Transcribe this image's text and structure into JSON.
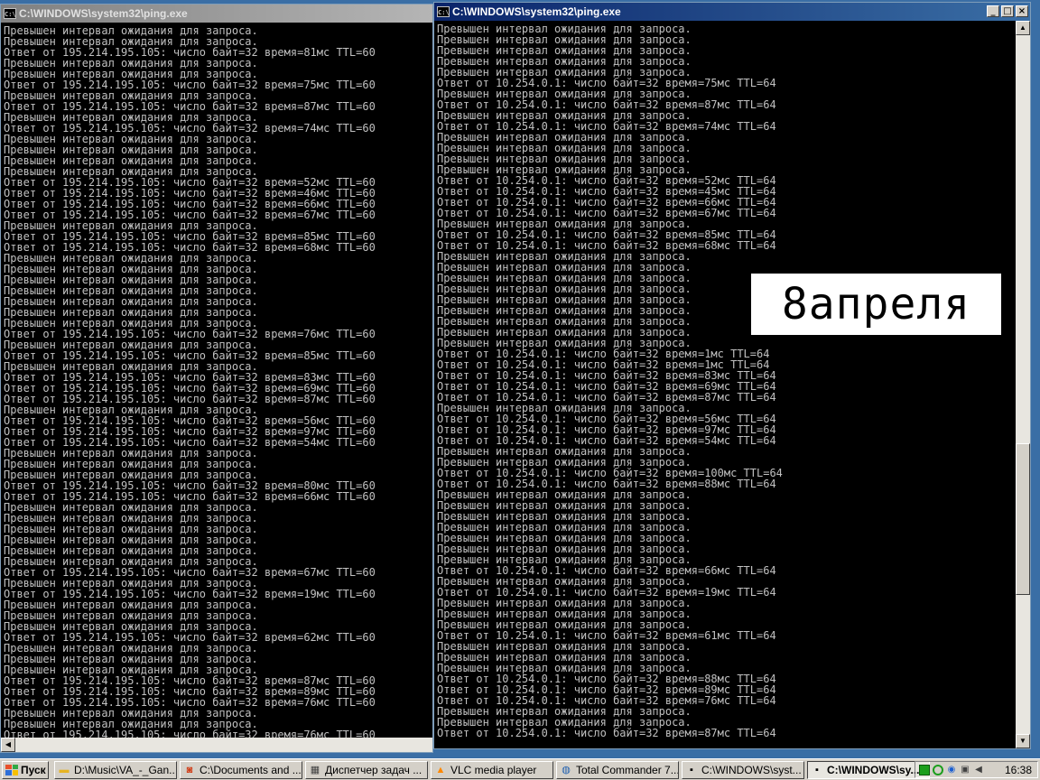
{
  "left_window": {
    "title": "C:\\WINDOWS\\system32\\ping.exe",
    "lines": [
      "Превышен интервал ожидания для запроса.",
      "Превышен интервал ожидания для запроса.",
      "Ответ от 195.214.195.105: число байт=32 время=81мс TTL=60",
      "Превышен интервал ожидания для запроса.",
      "Превышен интервал ожидания для запроса.",
      "Ответ от 195.214.195.105: число байт=32 время=75мс TTL=60",
      "Превышен интервал ожидания для запроса.",
      "Ответ от 195.214.195.105: число байт=32 время=87мс TTL=60",
      "Превышен интервал ожидания для запроса.",
      "Ответ от 195.214.195.105: число байт=32 время=74мс TTL=60",
      "Превышен интервал ожидания для запроса.",
      "Превышен интервал ожидания для запроса.",
      "Превышен интервал ожидания для запроса.",
      "Превышен интервал ожидания для запроса.",
      "Ответ от 195.214.195.105: число байт=32 время=52мс TTL=60",
      "Ответ от 195.214.195.105: число байт=32 время=46мс TTL=60",
      "Ответ от 195.214.195.105: число байт=32 время=66мс TTL=60",
      "Ответ от 195.214.195.105: число байт=32 время=67мс TTL=60",
      "Превышен интервал ожидания для запроса.",
      "Ответ от 195.214.195.105: число байт=32 время=85мс TTL=60",
      "Ответ от 195.214.195.105: число байт=32 время=68мс TTL=60",
      "Превышен интервал ожидания для запроса.",
      "Превышен интервал ожидания для запроса.",
      "Превышен интервал ожидания для запроса.",
      "Превышен интервал ожидания для запроса.",
      "Превышен интервал ожидания для запроса.",
      "Превышен интервал ожидания для запроса.",
      "Превышен интервал ожидания для запроса.",
      "Ответ от 195.214.195.105: число байт=32 время=76мс TTL=60",
      "Превышен интервал ожидания для запроса.",
      "Ответ от 195.214.195.105: число байт=32 время=85мс TTL=60",
      "Превышен интервал ожидания для запроса.",
      "Ответ от 195.214.195.105: число байт=32 время=83мс TTL=60",
      "Ответ от 195.214.195.105: число байт=32 время=69мс TTL=60",
      "Ответ от 195.214.195.105: число байт=32 время=87мс TTL=60",
      "Превышен интервал ожидания для запроса.",
      "Ответ от 195.214.195.105: число байт=32 время=56мс TTL=60",
      "Ответ от 195.214.195.105: число байт=32 время=97мс TTL=60",
      "Ответ от 195.214.195.105: число байт=32 время=54мс TTL=60",
      "Превышен интервал ожидания для запроса.",
      "Превышен интервал ожидания для запроса.",
      "Превышен интервал ожидания для запроса.",
      "Ответ от 195.214.195.105: число байт=32 время=80мс TTL=60",
      "Ответ от 195.214.195.105: число байт=32 время=66мс TTL=60",
      "Превышен интервал ожидания для запроса.",
      "Превышен интервал ожидания для запроса.",
      "Превышен интервал ожидания для запроса.",
      "Превышен интервал ожидания для запроса.",
      "Превышен интервал ожидания для запроса.",
      "Превышен интервал ожидания для запроса.",
      "Ответ от 195.214.195.105: число байт=32 время=67мс TTL=60",
      "Превышен интервал ожидания для запроса.",
      "Ответ от 195.214.195.105: число байт=32 время=19мс TTL=60",
      "Превышен интервал ожидания для запроса.",
      "Превышен интервал ожидания для запроса.",
      "Превышен интервал ожидания для запроса.",
      "Ответ от 195.214.195.105: число байт=32 время=62мс TTL=60",
      "Превышен интервал ожидания для запроса.",
      "Превышен интервал ожидания для запроса.",
      "Превышен интервал ожидания для запроса.",
      "Ответ от 195.214.195.105: число байт=32 время=87мс TTL=60",
      "Ответ от 195.214.195.105: число байт=32 время=89мс TTL=60",
      "Ответ от 195.214.195.105: число байт=32 время=76мс TTL=60",
      "Превышен интервал ожидания для запроса.",
      "Превышен интервал ожидания для запроса.",
      "Ответ от 195.214.195.105: число байт=32 время=76мс TTL=60"
    ]
  },
  "right_window": {
    "title": "C:\\WINDOWS\\system32\\ping.exe",
    "lines": [
      "Превышен интервал ожидания для запроса.",
      "Превышен интервал ожидания для запроса.",
      "Превышен интервал ожидания для запроса.",
      "Превышен интервал ожидания для запроса.",
      "Превышен интервал ожидания для запроса.",
      "Ответ от 10.254.0.1: число байт=32 время=75мс TTL=64",
      "Превышен интервал ожидания для запроса.",
      "Ответ от 10.254.0.1: число байт=32 время=87мс TTL=64",
      "Превышен интервал ожидания для запроса.",
      "Ответ от 10.254.0.1: число байт=32 время=74мс TTL=64",
      "Превышен интервал ожидания для запроса.",
      "Превышен интервал ожидания для запроса.",
      "Превышен интервал ожидания для запроса.",
      "Превышен интервал ожидания для запроса.",
      "Ответ от 10.254.0.1: число байт=32 время=52мс TTL=64",
      "Ответ от 10.254.0.1: число байт=32 время=45мс TTL=64",
      "Ответ от 10.254.0.1: число байт=32 время=66мс TTL=64",
      "Ответ от 10.254.0.1: число байт=32 время=67мс TTL=64",
      "Превышен интервал ожидания для запроса.",
      "Ответ от 10.254.0.1: число байт=32 время=85мс TTL=64",
      "Ответ от 10.254.0.1: число байт=32 время=68мс TTL=64",
      "Превышен интервал ожидания для запроса.",
      "Превышен интервал ожидания для запроса.",
      "Превышен интервал ожидания для запроса.",
      "Превышен интервал ожидания для запроса.",
      "Превышен интервал ожидания для запроса.",
      "Превышен интервал ожидания для запроса.",
      "Превышен интервал ожидания для запроса.",
      "Превышен интервал ожидания для запроса.",
      "Превышен интервал ожидания для запроса.",
      "Ответ от 10.254.0.1: число байт=32 время=1мс TTL=64",
      "Ответ от 10.254.0.1: число байт=32 время=1мс TTL=64",
      "Ответ от 10.254.0.1: число байт=32 время=83мс TTL=64",
      "Ответ от 10.254.0.1: число байт=32 время=69мс TTL=64",
      "Ответ от 10.254.0.1: число байт=32 время=87мс TTL=64",
      "Превышен интервал ожидания для запроса.",
      "Ответ от 10.254.0.1: число байт=32 время=56мс TTL=64",
      "Ответ от 10.254.0.1: число байт=32 время=97мс TTL=64",
      "Ответ от 10.254.0.1: число байт=32 время=54мс TTL=64",
      "Превышен интервал ожидания для запроса.",
      "Превышен интервал ожидания для запроса.",
      "Ответ от 10.254.0.1: число байт=32 время=100мс TTL=64",
      "Ответ от 10.254.0.1: число байт=32 время=88мс TTL=64",
      "Превышен интервал ожидания для запроса.",
      "Превышен интервал ожидания для запроса.",
      "Превышен интервал ожидания для запроса.",
      "Превышен интервал ожидания для запроса.",
      "Превышен интервал ожидания для запроса.",
      "Превышен интервал ожидания для запроса.",
      "Превышен интервал ожидания для запроса.",
      "Ответ от 10.254.0.1: число байт=32 время=66мс TTL=64",
      "Превышен интервал ожидания для запроса.",
      "Ответ от 10.254.0.1: число байт=32 время=19мс TTL=64",
      "Превышен интервал ожидания для запроса.",
      "Превышен интервал ожидания для запроса.",
      "Превышен интервал ожидания для запроса.",
      "Ответ от 10.254.0.1: число байт=32 время=61мс TTL=64",
      "Превышен интервал ожидания для запроса.",
      "Превышен интервал ожидания для запроса.",
      "Превышен интервал ожидания для запроса.",
      "Ответ от 10.254.0.1: число байт=32 время=88мс TTL=64",
      "Ответ от 10.254.0.1: число байт=32 время=89мс TTL=64",
      "Ответ от 10.254.0.1: число байт=32 время=76мс TTL=64",
      "Превышен интервал ожидания для запроса.",
      "Превышен интервал ожидания для запроса.",
      "Ответ от 10.254.0.1: число байт=32 время=87мс TTL=64"
    ]
  },
  "overlay_text": "8апреля",
  "taskbar": {
    "start_label": "Пуск",
    "tasks": [
      {
        "label": "D:\\Music\\VA_-_Gan...",
        "icon": "folder-icon",
        "active": false
      },
      {
        "label": "C:\\Documents and ...",
        "icon": "media-icon",
        "active": false
      },
      {
        "label": "Диспетчер задач ...",
        "icon": "task-manager-icon",
        "active": false
      },
      {
        "label": "VLC media player",
        "icon": "vlc-cone-icon",
        "active": false
      },
      {
        "label": "Total Commander 7....",
        "icon": "total-commander-icon",
        "active": false
      },
      {
        "label": "C:\\WINDOWS\\syst...",
        "icon": "console-icon",
        "active": false
      },
      {
        "label": "C:\\WINDOWS\\sy...",
        "icon": "console-icon",
        "active": true
      }
    ],
    "clock": "16:38"
  },
  "colors": {
    "console_bg": "#000000",
    "console_fg": "#c0c0c0",
    "titlebar_active": "#0a246a",
    "titlebar_inactive": "#808080",
    "taskbar_bg": "#d4d0c8"
  }
}
